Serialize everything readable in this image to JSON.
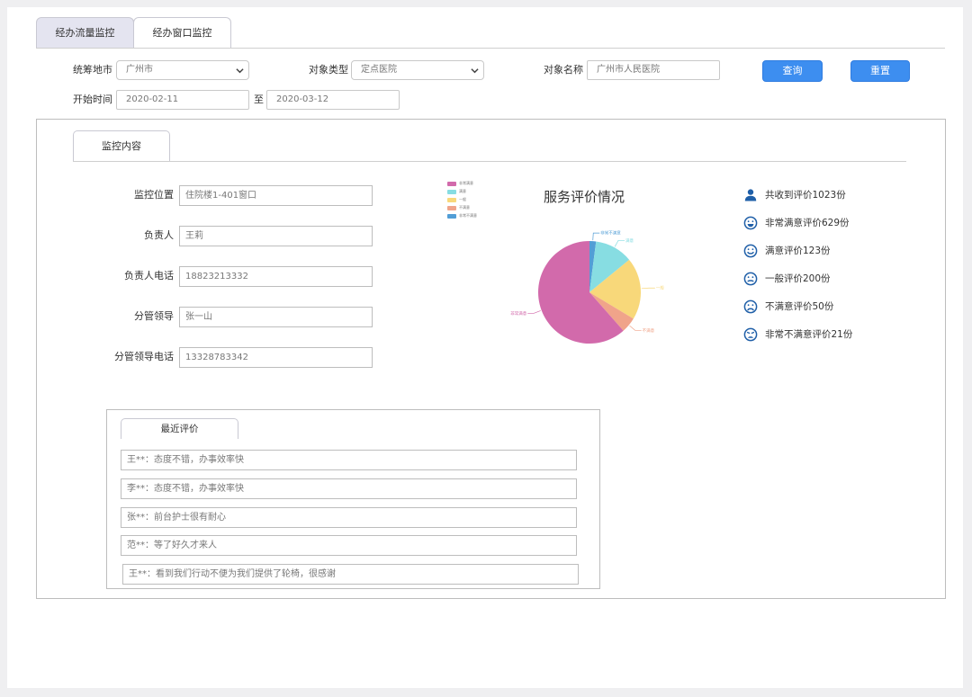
{
  "tabs": [
    {
      "label": "经办流量监控",
      "active": true
    },
    {
      "label": "经办窗口监控",
      "active": false
    }
  ],
  "filters": {
    "region_label": "统筹地市",
    "region_value": "广州市",
    "type_label": "对象类型",
    "type_value": "定点医院",
    "name_label": "对象名称",
    "name_value": "广州市人民医院",
    "start_label": "开始时间",
    "start_value": "2020-02-11",
    "to_label": "至",
    "end_value": "2020-03-12",
    "query_button": "查询",
    "reset_button": "重置"
  },
  "monitor": {
    "tab_label": "监控内容",
    "fields": [
      {
        "label": "监控位置",
        "value": "住院楼1-401窗口"
      },
      {
        "label": "负责人",
        "value": "王莉"
      },
      {
        "label": "负责人电话",
        "value": "18823213332"
      },
      {
        "label": "分管领导",
        "value": "张一山"
      },
      {
        "label": "分管领导电话",
        "value": "13328783342"
      }
    ]
  },
  "reviews": {
    "tab_label": "最近评价",
    "items": [
      "王**：态度不错，办事效率快",
      "李**：态度不错，办事效率快",
      "张**：前台护士很有耐心",
      "范**：等了好久才来人",
      "王**：看到我们行动不便为我们提供了轮椅，很感谢"
    ]
  },
  "chart_data": {
    "type": "pie",
    "title": "服务评价情况",
    "categories": [
      "非常满意",
      "满意",
      "一般",
      "不满意",
      "非常不满意"
    ],
    "values": [
      629,
      123,
      200,
      50,
      21
    ],
    "colors": [
      "#d26aab",
      "#87dde2",
      "#f8d87a",
      "#f0a48a",
      "#529ed6"
    ],
    "legend": "top-left"
  },
  "stats": [
    {
      "icon": "user-icon",
      "text": "共收到评价1023份"
    },
    {
      "icon": "very-happy-face-icon",
      "text": "非常满意评价629份"
    },
    {
      "icon": "smile-face-icon",
      "text": "满意评价123份"
    },
    {
      "icon": "neutral-face-icon",
      "text": "一般评价200份"
    },
    {
      "icon": "sad-face-icon",
      "text": "不满意评价50份"
    },
    {
      "icon": "very-sad-face-icon",
      "text": "非常不满意评价21份"
    }
  ],
  "colors": {
    "accent": "#3d8ef0",
    "icon": "#1f5fa8",
    "active_tab": "#e4e4f0"
  }
}
